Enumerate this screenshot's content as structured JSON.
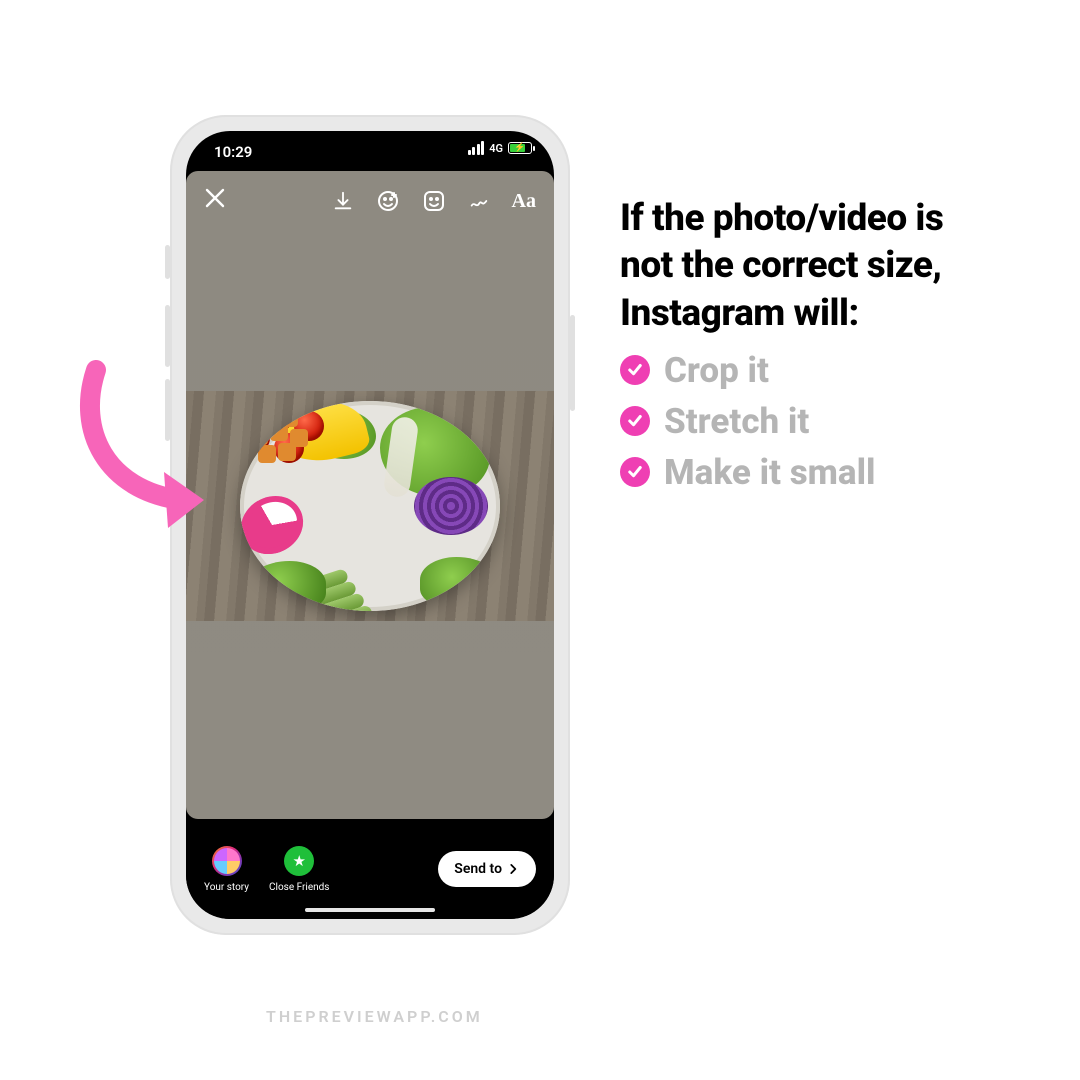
{
  "status": {
    "time": "10:29",
    "network": "4G"
  },
  "toolbar": {
    "text_tool": "Aa"
  },
  "bottom": {
    "your_story": "Your story",
    "close_friends": "Close Friends",
    "send_to": "Send to"
  },
  "copy": {
    "headline": "If the photo/video is not the correct size, Instagram will:",
    "items": [
      "Crop it",
      "Stretch it",
      "Make it small"
    ]
  },
  "watermark": "THEPREVIEWAPP.COM",
  "colors": {
    "accent_pink": "#ef3fb3",
    "arrow_pink": "#f765b9"
  }
}
